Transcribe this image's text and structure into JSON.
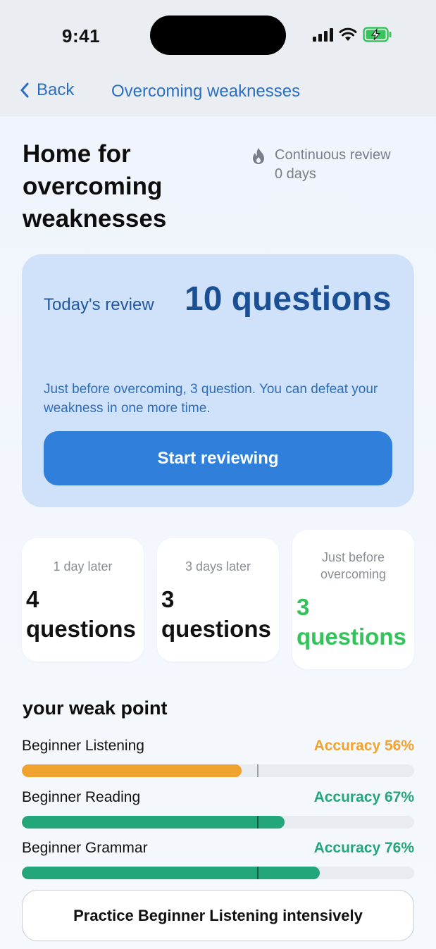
{
  "status_bar": {
    "time": "9:41"
  },
  "nav": {
    "back_label": "Back",
    "title": "Overcoming weaknesses"
  },
  "header": {
    "title": "Home for overcoming weaknesses",
    "streak_label": "Continuous review",
    "streak_value": "0 days"
  },
  "review": {
    "label": "Today's review",
    "count": "10 questions",
    "description": "Just before overcoming, 3 question. You can defeat your weakness in one more time.",
    "start_label": "Start reviewing"
  },
  "stats": [
    {
      "label": "1 day later",
      "value": "4 questions"
    },
    {
      "label": "3 days later",
      "value": "3 questions"
    },
    {
      "label": "Just before overcoming",
      "value": "3 questions",
      "color": "#34c25a"
    }
  ],
  "weak_points": {
    "title": "your weak point",
    "items": [
      {
        "name": "Beginner Listening",
        "accuracy_label": "Accuracy 56%",
        "accuracy": 56,
        "color": "#f0a32e"
      },
      {
        "name": "Beginner Reading",
        "accuracy_label": "Accuracy 67%",
        "accuracy": 67,
        "color": "#22a67a"
      },
      {
        "name": "Beginner Grammar",
        "accuracy_label": "Accuracy 76%",
        "accuracy": 76,
        "color": "#22a67a"
      }
    ],
    "target_accuracy": 60
  },
  "practice": {
    "label": "Practice Beginner Listening intensively"
  },
  "colors": {
    "accent": "#2f7fdb",
    "nav_text": "#2a6fc2",
    "card_bg": "#cfe2fa"
  }
}
